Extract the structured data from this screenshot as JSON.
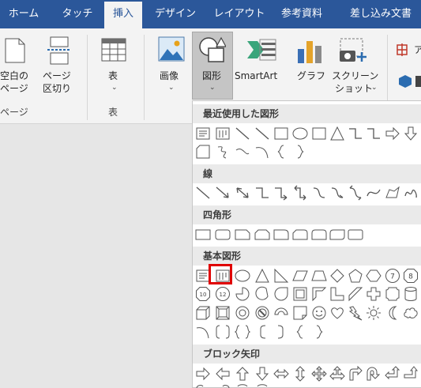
{
  "tabs": [
    "ホーム",
    "タッチ",
    "挿入",
    "デザイン",
    "レイアウト",
    "参考資料",
    "差し込み文書"
  ],
  "active_tab": "挿入",
  "ribbon": {
    "blank_page_label_1": "空白の",
    "blank_page_label_2": "ページ",
    "page_break_label_1": "ページ",
    "page_break_label_2": "区切り",
    "group_pages": "ページ",
    "table_label": "表",
    "group_table": "表",
    "image_label": "画像",
    "shapes_label": "図形",
    "smartart_label": "SmartArt",
    "graph_label": "グラフ",
    "screenshot_label_1": "スクリーン",
    "screenshot_label_2": "ショット",
    "chevron": "⌄",
    "partial_right": "ア"
  },
  "gallery": {
    "recent": "最近使用した図形",
    "lines": "線",
    "rectangles": "四角形",
    "basic": "基本図形",
    "block_arrows": "ブロック矢印",
    "badge_10": "10",
    "badge_12": "12",
    "badge_7": "7",
    "badge_8": "8"
  },
  "colors": {
    "tab_bar": "#2b579a",
    "ribbon": "#f3f3f3",
    "highlight_box": "#e00000"
  }
}
